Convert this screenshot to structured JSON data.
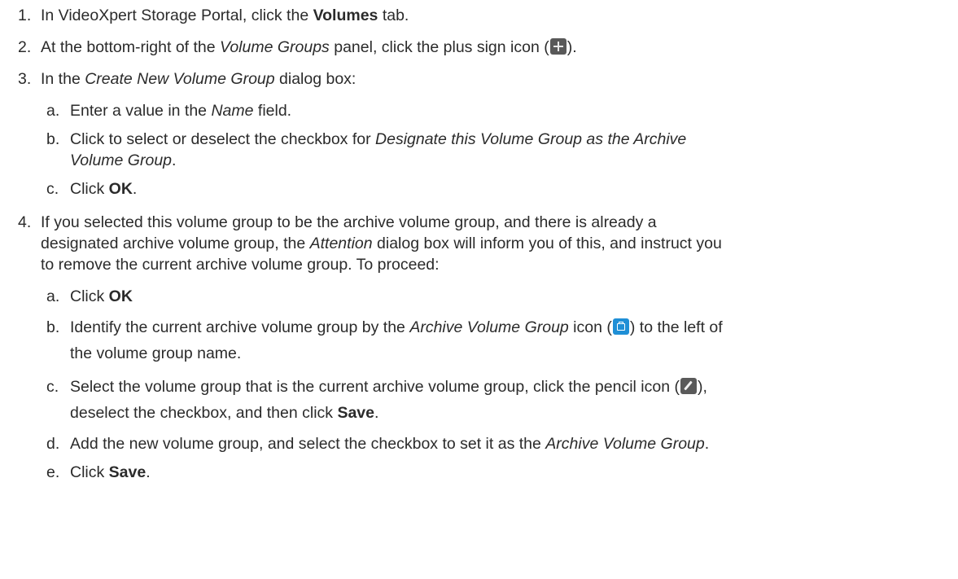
{
  "steps": [
    {
      "number": "1.",
      "before": "In VideoXpert Storage Portal, click the ",
      "bold": "Volumes",
      "after": " tab."
    },
    {
      "number": "2.",
      "before": "At the bottom-right of the ",
      "italic": "Volume Groups",
      "middle": " panel, click the plus sign icon (",
      "icon": "plus-icon",
      "after": ")."
    },
    {
      "number": "3.",
      "before": "In the ",
      "italic": "Create New Volume Group",
      "after": " dialog box:",
      "subs": [
        {
          "letter": "a.",
          "before": "Enter a value in the ",
          "italic": "Name",
          "after": " field."
        },
        {
          "letter": "b.",
          "before": "Click to select or deselect the checkbox for ",
          "italic_line1": "Designate this Volume Group as the Archive",
          "italic_line2": "Volume Group",
          "after": "."
        },
        {
          "letter": "c.",
          "before": "Click ",
          "bold": "OK",
          "after": "."
        }
      ]
    },
    {
      "number": "4.",
      "line1": "If you selected this volume group to be the archive volume group, and there is already a",
      "line2_before": "designated archive volume group, the ",
      "line2_italic": "Attention",
      "line2_after": " dialog box will inform you of this, and instruct you",
      "line3": "to remove the current archive volume group. To proceed:",
      "subs": [
        {
          "letter": "a.",
          "before": "Click ",
          "bold": "OK",
          "after": ""
        },
        {
          "letter": "b.",
          "before": "Identify the current archive volume group by the ",
          "italic": "Archive Volume Group",
          "middle": " icon (",
          "icon": "archive-volume-group-icon",
          "after": ") to the left of",
          "line2": "the volume group name."
        },
        {
          "letter": "c.",
          "before": "Select the volume group that is the current archive volume group, click the pencil icon (",
          "icon": "pencil-icon",
          "after": "),",
          "line2_before": "deselect the checkbox, and then click ",
          "line2_bold": "Save",
          "line2_after": "."
        },
        {
          "letter": "d.",
          "before": "Add the new volume group, and select the checkbox to set it as the ",
          "italic": "Archive Volume Group",
          "after": "."
        },
        {
          "letter": "e.",
          "before": "Click ",
          "bold": "Save",
          "after": "."
        }
      ]
    }
  ]
}
